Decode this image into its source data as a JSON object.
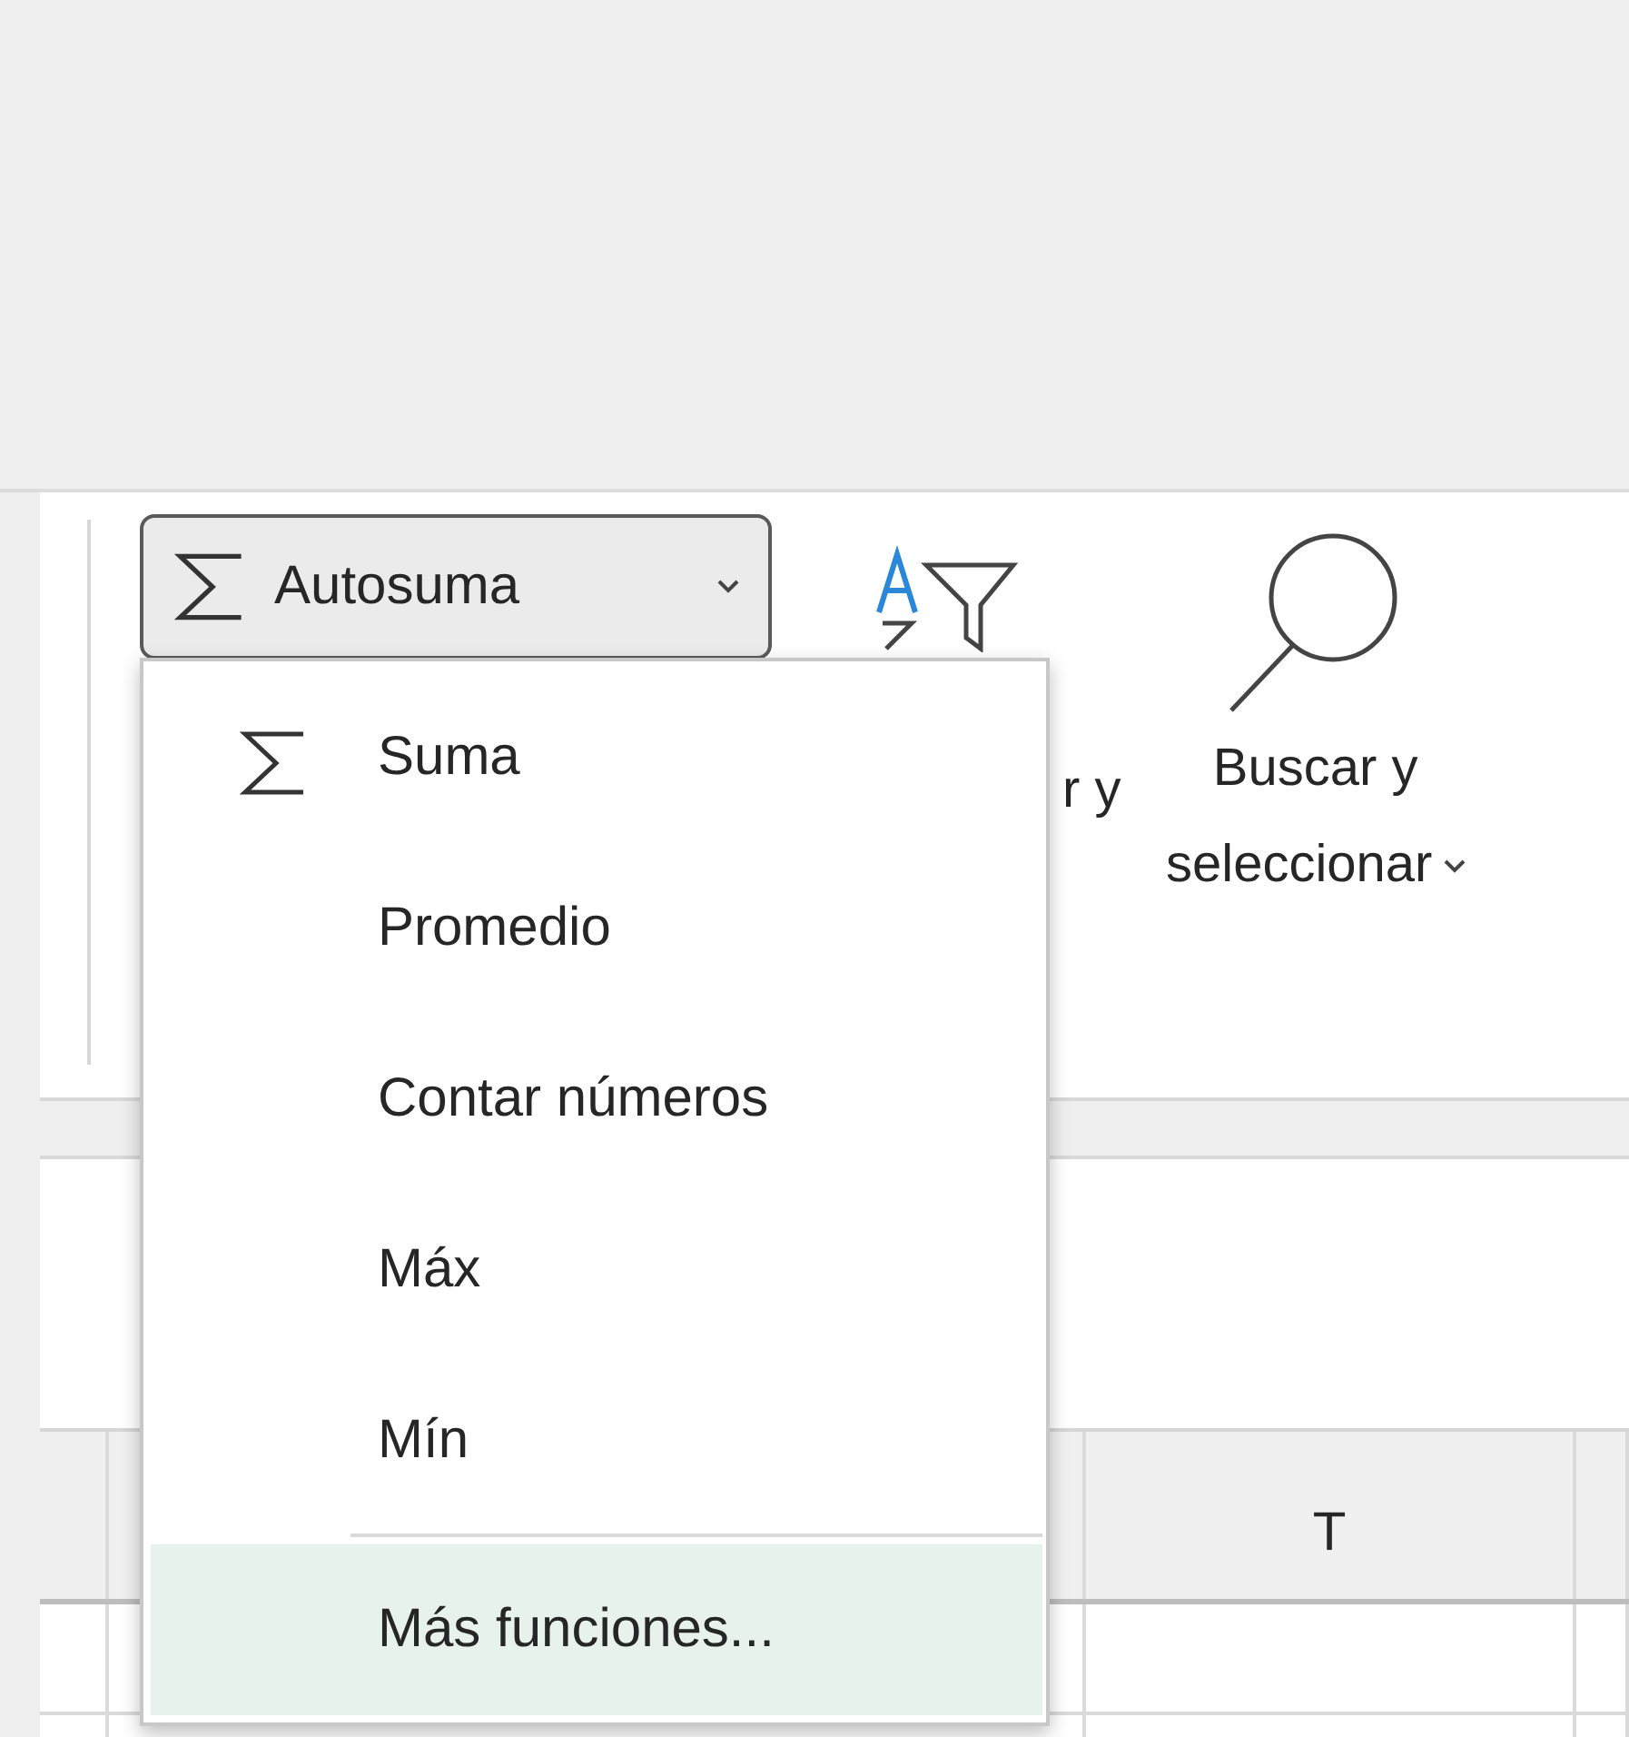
{
  "ribbon": {
    "autosum_button": {
      "label": "Autosuma",
      "expanded": true
    },
    "sort_group": {
      "label_visible": "r y"
    },
    "find_group": {
      "line_1": "Buscar y",
      "line_2": "seleccionar"
    }
  },
  "column_headers": [
    {
      "label": "T"
    }
  ],
  "autosum_menu": {
    "items": [
      {
        "kind": "sigma",
        "label": "Suma",
        "selected": false
      },
      {
        "kind": "text",
        "label": "Promedio",
        "selected": false
      },
      {
        "kind": "text",
        "label": "Contar números",
        "selected": false
      },
      {
        "kind": "text",
        "label": "Máx",
        "selected": false
      },
      {
        "kind": "text",
        "label": "Mín",
        "selected": false
      },
      {
        "kind": "separator"
      },
      {
        "kind": "text",
        "label": "Más funciones...",
        "selected": true
      }
    ]
  }
}
